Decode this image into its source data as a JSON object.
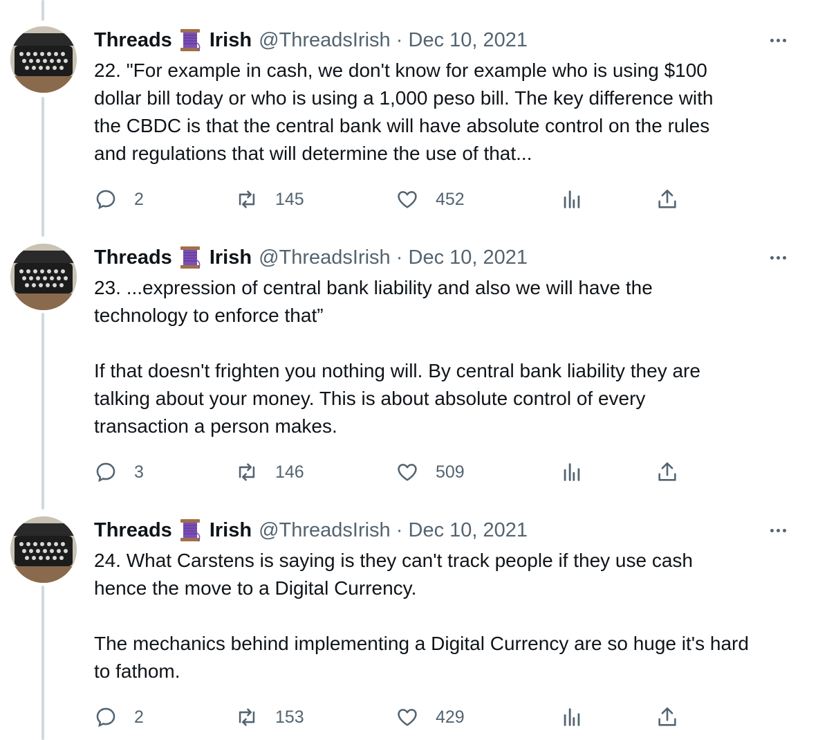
{
  "tweets": [
    {
      "display_name_first": "Threads",
      "display_name_last": "Irish",
      "handle": "@ThreadsIrish",
      "separator": "·",
      "date": "Dec 10, 2021",
      "text": "22. \"For example in cash, we don't know for example who is using $100\ndollar bill today or who is using a 1,000 peso bill. The key difference with\nthe CBDC is that the central bank will have absolute control on the rules\nand regulations that will determine the use of that...",
      "replies": "2",
      "retweets": "145",
      "likes": "452"
    },
    {
      "display_name_first": "Threads",
      "display_name_last": "Irish",
      "handle": "@ThreadsIrish",
      "separator": "·",
      "date": "Dec 10, 2021",
      "text": "23. ...expression of central bank liability and also we will have the\ntechnology to enforce that”\n\nIf that doesn't frighten you nothing will. By central bank liability they are\ntalking about your money. This is about absolute control of every\ntransaction a person makes.",
      "replies": "3",
      "retweets": "146",
      "likes": "509"
    },
    {
      "display_name_first": "Threads",
      "display_name_last": "Irish",
      "handle": "@ThreadsIrish",
      "separator": "·",
      "date": "Dec 10, 2021",
      "text": "24. What Carstens is saying is they can't track people if they use cash\nhence the move to a Digital Currency.\n\nThe mechanics behind implementing a Digital Currency are so huge it's hard\nto fathom.",
      "replies": "2",
      "retweets": "153",
      "likes": "429"
    }
  ],
  "icons": {
    "reply": "reply-icon",
    "retweet": "retweet-icon",
    "like": "heart-icon",
    "views": "analytics-icon",
    "share": "share-icon",
    "more": "more-icon",
    "emoji": "thread-spool-emoji"
  },
  "colors": {
    "text": "#0f1419",
    "secondary": "#536471",
    "thread_line": "#cfd9de",
    "spool": "#7b4fb5"
  }
}
